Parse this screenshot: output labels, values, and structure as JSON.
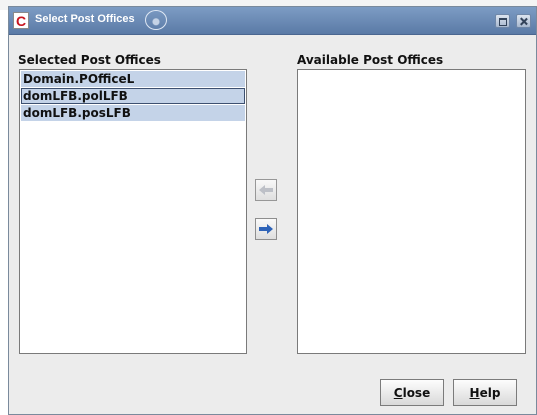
{
  "window": {
    "title": "Select Post Offices",
    "app_icon_letter": "C"
  },
  "selected": {
    "label": "Selected Post Offices",
    "items": [
      {
        "text": "Domain.POfficeL",
        "focused": false
      },
      {
        "text": "domLFB.polLFB",
        "focused": true
      },
      {
        "text": "domLFB.posLFB",
        "focused": false
      }
    ]
  },
  "available": {
    "label": "Available Post Offices",
    "items": []
  },
  "controls": {
    "add_icon": "left-arrow-icon",
    "remove_icon": "right-arrow-icon",
    "add_enabled": false,
    "remove_enabled": true,
    "arrow_color": "#2e63b8"
  },
  "buttons": {
    "close_mnemonic": "C",
    "close_rest": "lose",
    "help_mnemonic": "H",
    "help_rest": "elp"
  }
}
